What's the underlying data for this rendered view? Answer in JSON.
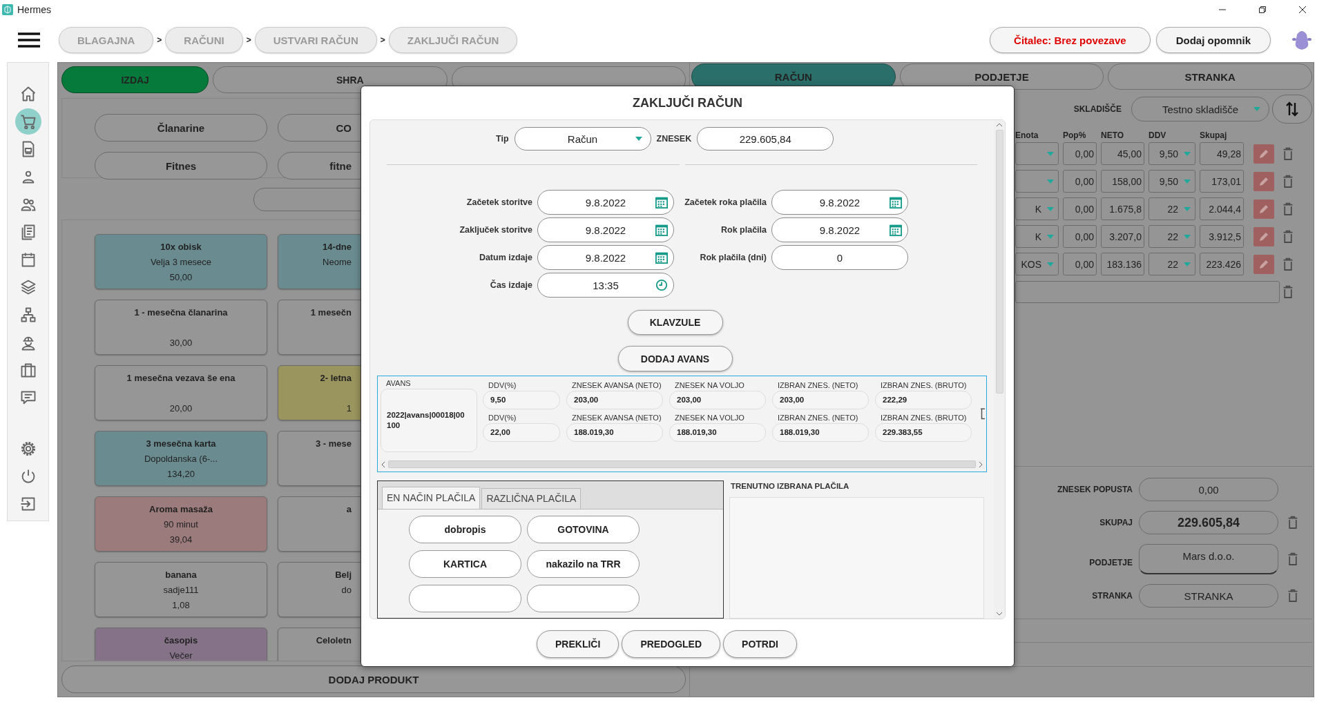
{
  "window": {
    "title": "Hermes"
  },
  "breadcrumbs": [
    {
      "label": "BLAGAJNA",
      "separator": ">"
    },
    {
      "label": "RAČUNI",
      "separator": ">"
    },
    {
      "label": "USTVARI RAČUN",
      "separator": ">"
    },
    {
      "label": "ZAKLJUČI RAČUN"
    }
  ],
  "header_buttons": [
    {
      "label": "Čitalec: Brez povezave",
      "kind": "alert"
    },
    {
      "label": "Dodaj opomnik",
      "kind": "normal"
    }
  ],
  "sidebar": {
    "items": [
      {
        "selected": false
      },
      {
        "selected": true
      },
      {
        "selected": false
      },
      {
        "selected": false
      },
      {
        "selected": false
      },
      {
        "selected": false
      },
      {
        "selected": false
      },
      {
        "selected": false
      },
      {
        "selected": false
      },
      {
        "selected": false
      },
      {
        "selected": false
      },
      {
        "selected": false
      }
    ],
    "bottom_items": [
      {
        "selected": false
      },
      {
        "selected": false
      },
      {
        "selected": false
      }
    ]
  },
  "sale": {
    "actions": [
      {
        "label": "IZDAJ",
        "kind": "primary"
      },
      {
        "label": "SHRA",
        "kind": "normal"
      },
      {
        "kind": "normal"
      }
    ],
    "categories": [
      "Članarine",
      "CO",
      "Fitnes",
      "fitne"
    ],
    "products": [
      {
        "name": "10x obisk",
        "description": "Velja 3 mesece",
        "price": "50,00",
        "color": "#6a8c90"
      },
      {
        "name": "14-dne",
        "description": "Neome",
        "color": "#6a8c90"
      },
      {
        "name": "1 - mesečna članarina",
        "price": "30,00",
        "color": "#969696"
      },
      {
        "name": "1 mesečn",
        "color": "#969696"
      },
      {
        "name": "1 mesečna vezava še ena",
        "price": "20,00",
        "color": "#969696"
      },
      {
        "name": "2- letna",
        "price": "1",
        "color": "#9a955e"
      },
      {
        "name": "3 mesečna karta",
        "description": "Dopoldanska (6-...",
        "price": "134,20",
        "color": "#6a8c90"
      },
      {
        "name": "3 - mese",
        "color": "#969696"
      },
      {
        "name": "Aroma masaža",
        "description": "90 minut",
        "price": "39,04",
        "color": "#9c7b7c"
      },
      {
        "name": "a",
        "color": "#969696"
      },
      {
        "name": "banana",
        "description": "sadje111",
        "price": "1,08",
        "color": "#969696"
      },
      {
        "name": "Belj",
        "description": "do",
        "color": "#969696"
      },
      {
        "name": "časopis",
        "description": "Večer",
        "color": "#857289"
      },
      {
        "name": "Celoletn",
        "color": "#969696"
      }
    ],
    "add_product": "DODAJ PRODUKT"
  },
  "invoice": {
    "tabs": [
      {
        "label": "RAČUN",
        "selected": true
      },
      {
        "label": "PODJETJE",
        "selected": false
      },
      {
        "label": "STRANKA",
        "selected": false
      }
    ],
    "warehouse": {
      "label": "SKLADIŠČE",
      "value": "Testno skladišče"
    },
    "columns": [
      "Enota",
      "Pop%",
      "NETO",
      "DDV",
      "Skupaj"
    ],
    "rows": [
      {
        "unit": "",
        "discount": "0,00",
        "net": "45,00",
        "vat": "9,50",
        "total": "49,28"
      },
      {
        "unit": "",
        "discount": "0,00",
        "net": "158,00",
        "vat": "9,50",
        "total": "173,01"
      },
      {
        "unit": "K",
        "discount": "0,00",
        "net": "1.675,8",
        "vat": "22",
        "total": "2.044,4"
      },
      {
        "unit": "K",
        "discount": "0,00",
        "net": "3.207,0",
        "vat": "22",
        "total": "3.912,5"
      },
      {
        "unit": "KOS",
        "discount": "0,00",
        "net": "183.136",
        "vat": "22",
        "total": "223.426"
      }
    ],
    "summary": [
      {
        "label": "ZNESEK POPUSTA",
        "value": "0,00",
        "kind": "plain",
        "removable": false
      },
      {
        "label": "SKUPAJ",
        "value": "229.605,84",
        "kind": "total",
        "removable": true
      },
      {
        "label": "PODJETJE",
        "value": "Mars d.o.o.",
        "kind": "company",
        "removable": true
      },
      {
        "label": "STRANKA",
        "value": "STRANKA",
        "kind": "plain",
        "removable": true
      }
    ]
  },
  "dialog": {
    "title": "ZAKLJUČI RAČUN",
    "type": {
      "label": "Tip",
      "value": "Račun"
    },
    "amount": {
      "label": "ZNESEK",
      "value": "229.605,84"
    },
    "left_fields": [
      {
        "label": "Začetek storitve",
        "value": "9.8.2022",
        "kind": "date"
      },
      {
        "label": "Zaključek storitve",
        "value": "9.8.2022",
        "kind": "date"
      },
      {
        "label": "Datum izdaje",
        "value": "9.8.2022",
        "kind": "date"
      },
      {
        "label": "Čas izdaje",
        "value": "13:35",
        "kind": "time"
      }
    ],
    "right_fields": [
      {
        "label": "Začetek roka plačila",
        "value": "9.8.2022",
        "kind": "date"
      },
      {
        "label": "Rok plačila",
        "value": "9.8.2022",
        "kind": "date"
      },
      {
        "label": "Rok plačila (dni)",
        "value": "0",
        "kind": "number"
      }
    ],
    "clauses_button": "KLAVZULE",
    "advance_button": "DODAJ AVANS",
    "advance": {
      "label": "AVANS",
      "document": "2022|avans|00018|00100",
      "rows": [
        [
          {
            "label": "DDV(%)",
            "value": "9,50"
          },
          {
            "label": "ZNESEK AVANSA (NETO)",
            "value": "203,00"
          },
          {
            "label": "ZNESEK NA VOLJO",
            "value": "203,00"
          },
          {
            "label": "IZBRAN ZNES. (NETO)",
            "value": "203,00"
          },
          {
            "label": "IZBRAN ZNES. (BRUTO)",
            "value": "222,29"
          }
        ],
        [
          {
            "label": "DDV(%)",
            "value": "22,00"
          },
          {
            "label": "ZNESEK AVANSA (NETO)",
            "value": "188.019,30"
          },
          {
            "label": "ZNESEK NA VOLJO",
            "value": "188.019,30"
          },
          {
            "label": "IZBRAN ZNES. (NETO)",
            "value": "188.019,30"
          },
          {
            "label": "IZBRAN ZNES. (BRUTO)",
            "value": "229.383,55"
          }
        ]
      ]
    },
    "payment_tabs": [
      {
        "label": "EN NAČIN PLAČILA",
        "selected": true
      },
      {
        "label": "RAZLIČNA PLAČILA",
        "selected": false
      }
    ],
    "payment_methods": [
      "dobropis",
      "GOTOVINA",
      "KARTICA",
      "nakazilo na TRR"
    ],
    "selected_payments_title": "TRENUTNO IZBRANA PLAČILA",
    "buttons": [
      "PREKLIČI",
      "PREDOGLED",
      "POTRDI"
    ]
  }
}
